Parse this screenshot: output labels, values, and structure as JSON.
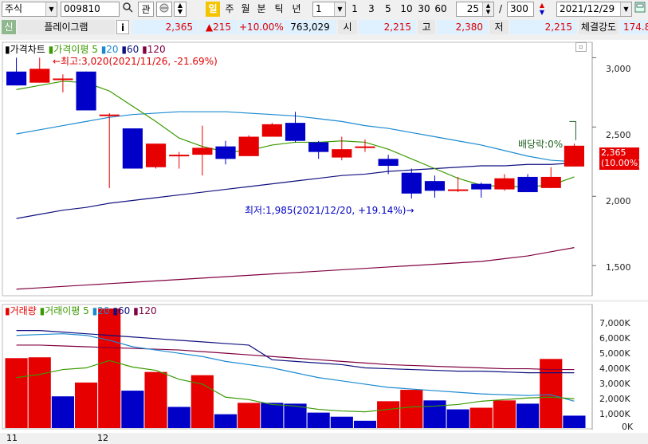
{
  "toolbar": {
    "market": "주식",
    "code": "009810",
    "icon_watch": "관",
    "hl_badge": "일",
    "periods": [
      "주",
      "월",
      "분",
      "틱",
      "년"
    ],
    "interval_value": "1",
    "quick_intervals": [
      "1",
      "3",
      "5",
      "10",
      "30",
      "60"
    ],
    "view_count": "25",
    "total_count": "300",
    "date": "2021/12/29"
  },
  "infobar": {
    "marker": "신",
    "name": "플레이그램",
    "info_button": "i",
    "price": "2,365",
    "change": "▲215",
    "change_rate": "+10.00%",
    "volume": "763,029",
    "open_label": "시",
    "open": "2,215",
    "high_label": "고",
    "high": "2,380",
    "low_label": "저",
    "low": "2,215",
    "strength_label": "체결강도",
    "strength": "174.8"
  },
  "price_chart": {
    "legend_title": "가격차트",
    "legend_ma_label": "가격이평",
    "legend_ma": [
      "5",
      "20",
      "60",
      "120"
    ],
    "high_annotation": "←최고:3,020(2021/11/26, -21.69%)",
    "low_annotation": "최저:1,985(2021/12/20, +19.14%)→",
    "dividend_annotation": "배당락:0%",
    "price_tag": "2,365",
    "price_tag_rate": "(10.00%)",
    "y_ticks": [
      "3,000",
      "2,500",
      "2,000",
      "1,500"
    ]
  },
  "volume_chart": {
    "legend_title": "거래량",
    "legend_ma_label": "거래이평",
    "legend_ma": [
      "5",
      "20",
      "60",
      "120"
    ],
    "y_ticks": [
      "7,000K",
      "6,000K",
      "5,000K",
      "4,000K",
      "3,000K",
      "2,000K",
      "1,000K",
      "0K"
    ]
  },
  "x_labels": [
    "11",
    "12"
  ],
  "colors": {
    "up": "#e60000",
    "down": "#0000c8",
    "ma5": "#3a9a00",
    "ma20": "#1a8ad0",
    "ma60": "#101080",
    "ma120": "#800040"
  },
  "chart_data": {
    "type": "candlestick",
    "candles": [
      {
        "o": 2900,
        "h": 3000,
        "l": 2800,
        "c": 2800
      },
      {
        "o": 2820,
        "h": 3000,
        "l": 2820,
        "c": 2920
      },
      {
        "o": 2850,
        "h": 2880,
        "l": 2750,
        "c": 2850
      },
      {
        "o": 2900,
        "h": 2900,
        "l": 2650,
        "c": 2620
      },
      {
        "o": 2590,
        "h": 2600,
        "l": 2060,
        "c": 2590
      },
      {
        "o": 2490,
        "h": 2490,
        "l": 2200,
        "c": 2200
      },
      {
        "o": 2210,
        "h": 2380,
        "l": 2200,
        "c": 2380
      },
      {
        "o": 2300,
        "h": 2320,
        "l": 2200,
        "c": 2300
      },
      {
        "o": 2300,
        "h": 2510,
        "l": 2150,
        "c": 2350
      },
      {
        "o": 2360,
        "h": 2400,
        "l": 2230,
        "c": 2270
      },
      {
        "o": 2290,
        "h": 2440,
        "l": 2290,
        "c": 2430
      },
      {
        "o": 2430,
        "h": 2530,
        "l": 2430,
        "c": 2520
      },
      {
        "o": 2530,
        "h": 2610,
        "l": 2390,
        "c": 2400
      },
      {
        "o": 2390,
        "h": 2400,
        "l": 2270,
        "c": 2320
      },
      {
        "o": 2280,
        "h": 2430,
        "l": 2260,
        "c": 2340
      },
      {
        "o": 2360,
        "h": 2410,
        "l": 2320,
        "c": 2360
      },
      {
        "o": 2270,
        "h": 2300,
        "l": 2160,
        "c": 2220
      },
      {
        "o": 2170,
        "h": 2200,
        "l": 1985,
        "c": 2020
      },
      {
        "o": 2110,
        "h": 2150,
        "l": 1990,
        "c": 2040
      },
      {
        "o": 2040,
        "h": 2140,
        "l": 2030,
        "c": 2050
      },
      {
        "o": 2090,
        "h": 2100,
        "l": 1990,
        "c": 2050
      },
      {
        "o": 2050,
        "h": 2160,
        "l": 2040,
        "c": 2130
      },
      {
        "o": 2140,
        "h": 2160,
        "l": 2030,
        "c": 2030
      },
      {
        "o": 2060,
        "h": 2210,
        "l": 2060,
        "c": 2140
      },
      {
        "o": 2215,
        "h": 2380,
        "l": 2215,
        "c": 2365
      }
    ],
    "ma5": [
      2770,
      2800,
      2830,
      2820,
      2760,
      2650,
      2540,
      2420,
      2360,
      2320,
      2330,
      2370,
      2390,
      2390,
      2400,
      2390,
      2340,
      2270,
      2200,
      2130,
      2080,
      2070,
      2070,
      2080,
      2140
    ],
    "ma20": [
      2450,
      2480,
      2510,
      2540,
      2570,
      2590,
      2600,
      2610,
      2610,
      2610,
      2600,
      2590,
      2580,
      2560,
      2540,
      2510,
      2490,
      2460,
      2430,
      2400,
      2370,
      2330,
      2290,
      2260,
      2250
    ],
    "ma60": [
      1840,
      1870,
      1900,
      1920,
      1950,
      1970,
      1990,
      2010,
      2030,
      2050,
      2070,
      2090,
      2110,
      2130,
      2150,
      2160,
      2180,
      2190,
      2200,
      2210,
      2220,
      2220,
      2230,
      2230,
      2240
    ],
    "ma120": [
      1330,
      1340,
      1350,
      1360,
      1370,
      1380,
      1390,
      1400,
      1410,
      1420,
      1430,
      1440,
      1450,
      1460,
      1470,
      1480,
      1490,
      1500,
      1510,
      1520,
      1530,
      1550,
      1570,
      1600,
      1630
    ],
    "y_range": [
      1300,
      3100
    ],
    "volume": [
      4300,
      4350,
      1950,
      2800,
      7350,
      2300,
      3450,
      1300,
      3250,
      850,
      1550,
      1550,
      1500,
      950,
      700,
      450,
      1650,
      2350,
      1700,
      1150,
      1250,
      1700,
      1500,
      4250,
      763
    ],
    "volume_up": [
      true,
      true,
      false,
      true,
      true,
      false,
      true,
      false,
      true,
      false,
      true,
      false,
      false,
      false,
      false,
      false,
      true,
      true,
      false,
      false,
      true,
      true,
      false,
      true,
      false
    ],
    "vol_ma5": [
      3100,
      3300,
      3600,
      3700,
      4150,
      3750,
      3550,
      3000,
      2700,
      1900,
      1750,
      1450,
      1350,
      1150,
      1050,
      1000,
      1150,
      1300,
      1350,
      1450,
      1650,
      1750,
      1850,
      1900,
      1800
    ],
    "vol_ma20": [
      5700,
      5750,
      5800,
      5700,
      5400,
      5000,
      4800,
      4600,
      4400,
      4100,
      3900,
      3700,
      3400,
      3100,
      2900,
      2700,
      2500,
      2400,
      2300,
      2200,
      2100,
      2050,
      2000,
      2050,
      1650
    ],
    "vol_ma60": [
      6000,
      6000,
      5900,
      5800,
      5700,
      5600,
      5500,
      5400,
      5300,
      5200,
      5100,
      4200,
      4100,
      4000,
      3900,
      3700,
      3650,
      3600,
      3550,
      3500,
      3500,
      3450,
      3400,
      3400,
      3400
    ],
    "vol_ma120": [
      5100,
      5100,
      5050,
      5000,
      4950,
      4900,
      4850,
      4800,
      4700,
      4600,
      4500,
      4400,
      4300,
      4200,
      4100,
      4000,
      3900,
      3850,
      3800,
      3750,
      3700,
      3650,
      3650,
      3600,
      3600
    ],
    "volume_range": [
      0,
      7500
    ]
  }
}
